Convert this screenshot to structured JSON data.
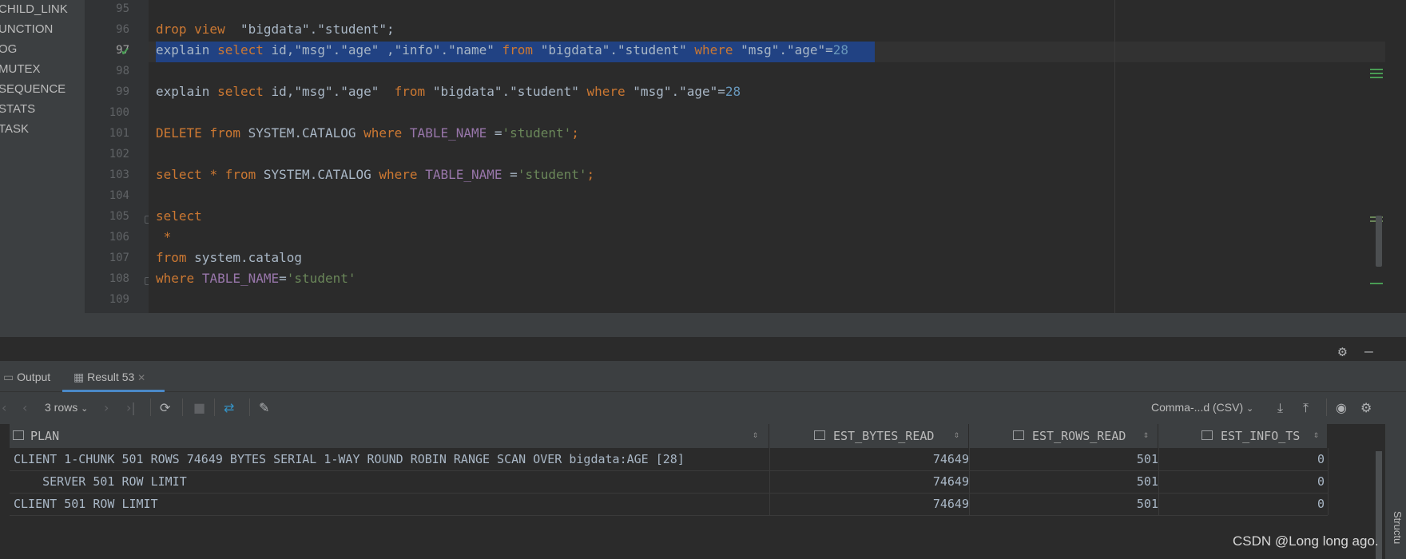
{
  "sidebar": {
    "items": [
      "CHILD_LINK",
      "UNCTION",
      "OG",
      "MUTEX",
      "SEQUENCE",
      "STATS",
      "TASK"
    ]
  },
  "editor": {
    "line_numbers": [
      "95",
      "96",
      "97",
      "98",
      "99",
      "100",
      "101",
      "102",
      "103",
      "104",
      "105",
      "106",
      "107",
      "108",
      "109"
    ],
    "line96": {
      "kw1": "drop view",
      "rest": "\"bigdata\".\"student\";"
    },
    "line97": {
      "kw1": "explain",
      "kw2": "select",
      "p1": "id,\"msg\".\"age\" ,\"info\".\"name\"",
      "kw3": "from",
      "p2": "\"bigdata\".\"student\"",
      "kw4": "where",
      "p3": "\"msg\".\"age\"=",
      "num": "28"
    },
    "line99": {
      "kw1": "explain",
      "kw2": "select",
      "p1": "id,\"msg\".\"age\"",
      "kw3": "from",
      "p2": "\"bigdata\".\"student\"",
      "kw4": "where",
      "p3": "\"msg\".\"age\"=",
      "num": "28"
    },
    "line101": {
      "kw1": "DELETE",
      "kw2": "from",
      "p1": "SYSTEM.CATALOG",
      "kw3": "where",
      "col": "TABLE_NAME",
      "eq": "=",
      "lit": "'student'",
      "end": ";"
    },
    "line103": {
      "kw1": "select",
      "star": "*",
      "kw2": "from",
      "p1": "SYSTEM.CATALOG",
      "kw3": "where",
      "col": "TABLE_NAME",
      "eq": "=",
      "lit": "'student'",
      "end": ";"
    },
    "line105": "select",
    "line106": "*",
    "line107": {
      "kw": "from",
      "p": "system.catalog"
    },
    "line108": {
      "kw": "where",
      "col": "TABLE_NAME",
      "eq": "=",
      "lit": "'student'"
    }
  },
  "panel": {
    "tabs": [
      {
        "label": "Output",
        "icon": "output-icon"
      },
      {
        "label": "Result 53",
        "icon": "table-icon",
        "close": "✕"
      }
    ]
  },
  "toolbar": {
    "rows_label": "3 rows",
    "format_label": "Comma-...d (CSV)"
  },
  "grid": {
    "columns": [
      "PLAN",
      "EST_BYTES_READ",
      "EST_ROWS_READ",
      "EST_INFO_TS"
    ],
    "rows": [
      [
        "CLIENT 1-CHUNK 501 ROWS 74649 BYTES SERIAL 1-WAY ROUND ROBIN RANGE SCAN OVER bigdata:AGE [28]",
        "74649",
        "501",
        "0"
      ],
      [
        "    SERVER 501 ROW LIMIT",
        "74649",
        "501",
        "0"
      ],
      [
        "CLIENT 501 ROW LIMIT",
        "74649",
        "501",
        "0"
      ]
    ]
  },
  "side_panel": {
    "structure_label": "Structu"
  },
  "watermark": "CSDN @Long long ago."
}
